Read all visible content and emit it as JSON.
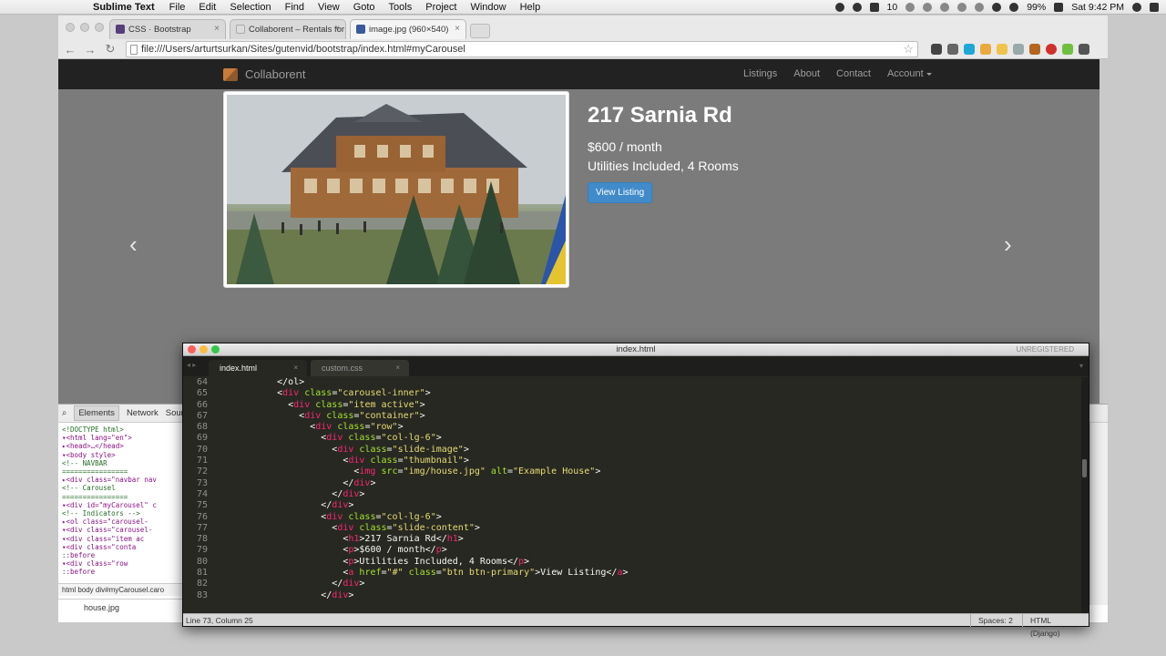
{
  "menubar": {
    "app": "Sublime Text",
    "items": [
      "File",
      "Edit",
      "Selection",
      "Find",
      "View",
      "Goto",
      "Tools",
      "Project",
      "Window",
      "Help"
    ],
    "status": {
      "notifications": "10",
      "battery": "99%",
      "clock": "Sat 9:42 PM"
    }
  },
  "browser": {
    "tabs": [
      {
        "label": "CSS · Bootstrap",
        "color": "#563d7c",
        "active": false
      },
      {
        "label": "Collaborent – Rentals for i",
        "color": "#dddddd",
        "active": false
      },
      {
        "label": "image.jpg (960×540)",
        "color": "#3b5998",
        "active": true
      }
    ],
    "url": "file:///Users/arturtsurkan/Sites/gutenvid/bootstrap/index.html#myCarousel"
  },
  "site": {
    "brand": "Collaborent",
    "nav": [
      "Listings",
      "About",
      "Contact",
      "Account"
    ],
    "slide": {
      "title": "217 Sarnia Rd",
      "price": "$600 / month",
      "details": "Utilities Included, 4 Rooms",
      "button": "View Listing"
    },
    "prev_glyph": "‹",
    "next_glyph": "›"
  },
  "devtools": {
    "tabs": [
      "Elements",
      "Network",
      "Source"
    ],
    "tree": [
      "<!DOCTYPE html>",
      "▾<html lang=\"en\">",
      " ▸<head>…</head>",
      " ▾<body style>",
      "   <!-- NAVBAR",
      "   ================",
      "  ▸<div class=\"navbar nav",
      "   <!-- Carousel",
      "   ================",
      "  ▾<div id=\"myCarousel\" c",
      "     <!-- Indicators -->",
      "    ▸<ol class=\"carousel-",
      "    ▾<div class=\"carousel-",
      "      ▾<div class=\"item ac",
      "        ▾<div class=\"conta",
      "            ::before",
      "          ▾<div class=\"row",
      "              ::before"
    ],
    "crumbs": "html   body   div#myCarousel.caro",
    "file": "house.jpg"
  },
  "editor": {
    "window_title": "index.html",
    "unregistered": "UNREGISTERED",
    "tabs": [
      "index.html",
      "custom.css"
    ],
    "lines": [
      {
        "n": "64",
        "html": "    &lt;/ol&gt;"
      },
      {
        "n": "65",
        "html": "    &lt;<span class='t'>div</span> <span class='a'>class</span>=<span class='s'>\"carousel-inner\"</span>&gt;"
      },
      {
        "n": "66",
        "html": "      &lt;<span class='t'>div</span> <span class='a'>class</span>=<span class='s'>\"item active\"</span>&gt;"
      },
      {
        "n": "67",
        "html": "        &lt;<span class='t'>div</span> <span class='a'>class</span>=<span class='s'>\"container\"</span>&gt;"
      },
      {
        "n": "68",
        "html": "          &lt;<span class='t'>div</span> <span class='a'>class</span>=<span class='s'>\"row\"</span>&gt;"
      },
      {
        "n": "69",
        "html": "            &lt;<span class='t'>div</span> <span class='a'>class</span>=<span class='s'>\"col-lg-6\"</span>&gt;"
      },
      {
        "n": "70",
        "html": "              &lt;<span class='t'>div</span> <span class='a'>class</span>=<span class='s'>\"slide-image\"</span>&gt;"
      },
      {
        "n": "71",
        "html": "                &lt;<span class='t'>div</span> <span class='a'>class</span>=<span class='s'>\"thumbnail\"</span>&gt;"
      },
      {
        "n": "72",
        "html": "                  &lt;<span class='t'>img</span> <span class='a'>src</span>=<span class='s'>\"img/house.jpg\"</span> <span class='a'>alt</span>=<span class='s'>\"Example House\"</span>&gt;"
      },
      {
        "n": "73",
        "html": "                &lt;/<span class='t'>div</span>&gt;"
      },
      {
        "n": "74",
        "html": "              &lt;/<span class='t'>div</span>&gt;"
      },
      {
        "n": "75",
        "html": "            &lt;/<span class='t'>div</span>&gt;"
      },
      {
        "n": "76",
        "html": "            &lt;<span class='t'>div</span> <span class='a'>class</span>=<span class='s'>\"col-lg-6\"</span>&gt;"
      },
      {
        "n": "77",
        "html": "              &lt;<span class='t'>div</span> <span class='a'>class</span>=<span class='s'>\"slide-content\"</span>&gt;"
      },
      {
        "n": "78",
        "html": "                &lt;<span class='t'>h1</span>&gt;217 Sarnia Rd&lt;/<span class='t'>h1</span>&gt;"
      },
      {
        "n": "79",
        "html": "                &lt;<span class='t'>p</span>&gt;$600 / month&lt;/<span class='t'>p</span>&gt;"
      },
      {
        "n": "80",
        "html": "                &lt;<span class='t'>p</span>&gt;Utilities Included, 4 Rooms&lt;/<span class='t'>p</span>&gt;"
      },
      {
        "n": "81",
        "html": "                &lt;<span class='t'>a</span> <span class='a'>href</span>=<span class='s'>\"#\"</span> <span class='a'>class</span>=<span class='s'>\"btn btn-primary\"</span>&gt;View Listing&lt;/<span class='t'>a</span>&gt;"
      },
      {
        "n": "82",
        "html": "              &lt;/<span class='t'>div</span>&gt;"
      },
      {
        "n": "83",
        "html": "            &lt;/<span class='t'>div</span>&gt;"
      }
    ],
    "status_left": "Line 73, Column 25",
    "spaces": "Spaces: 2",
    "syntax": "HTML (Django)"
  },
  "colors": {
    "sublime_bg": "#272822",
    "bootstrap_primary": "#428bca",
    "navbar": "#222222"
  }
}
